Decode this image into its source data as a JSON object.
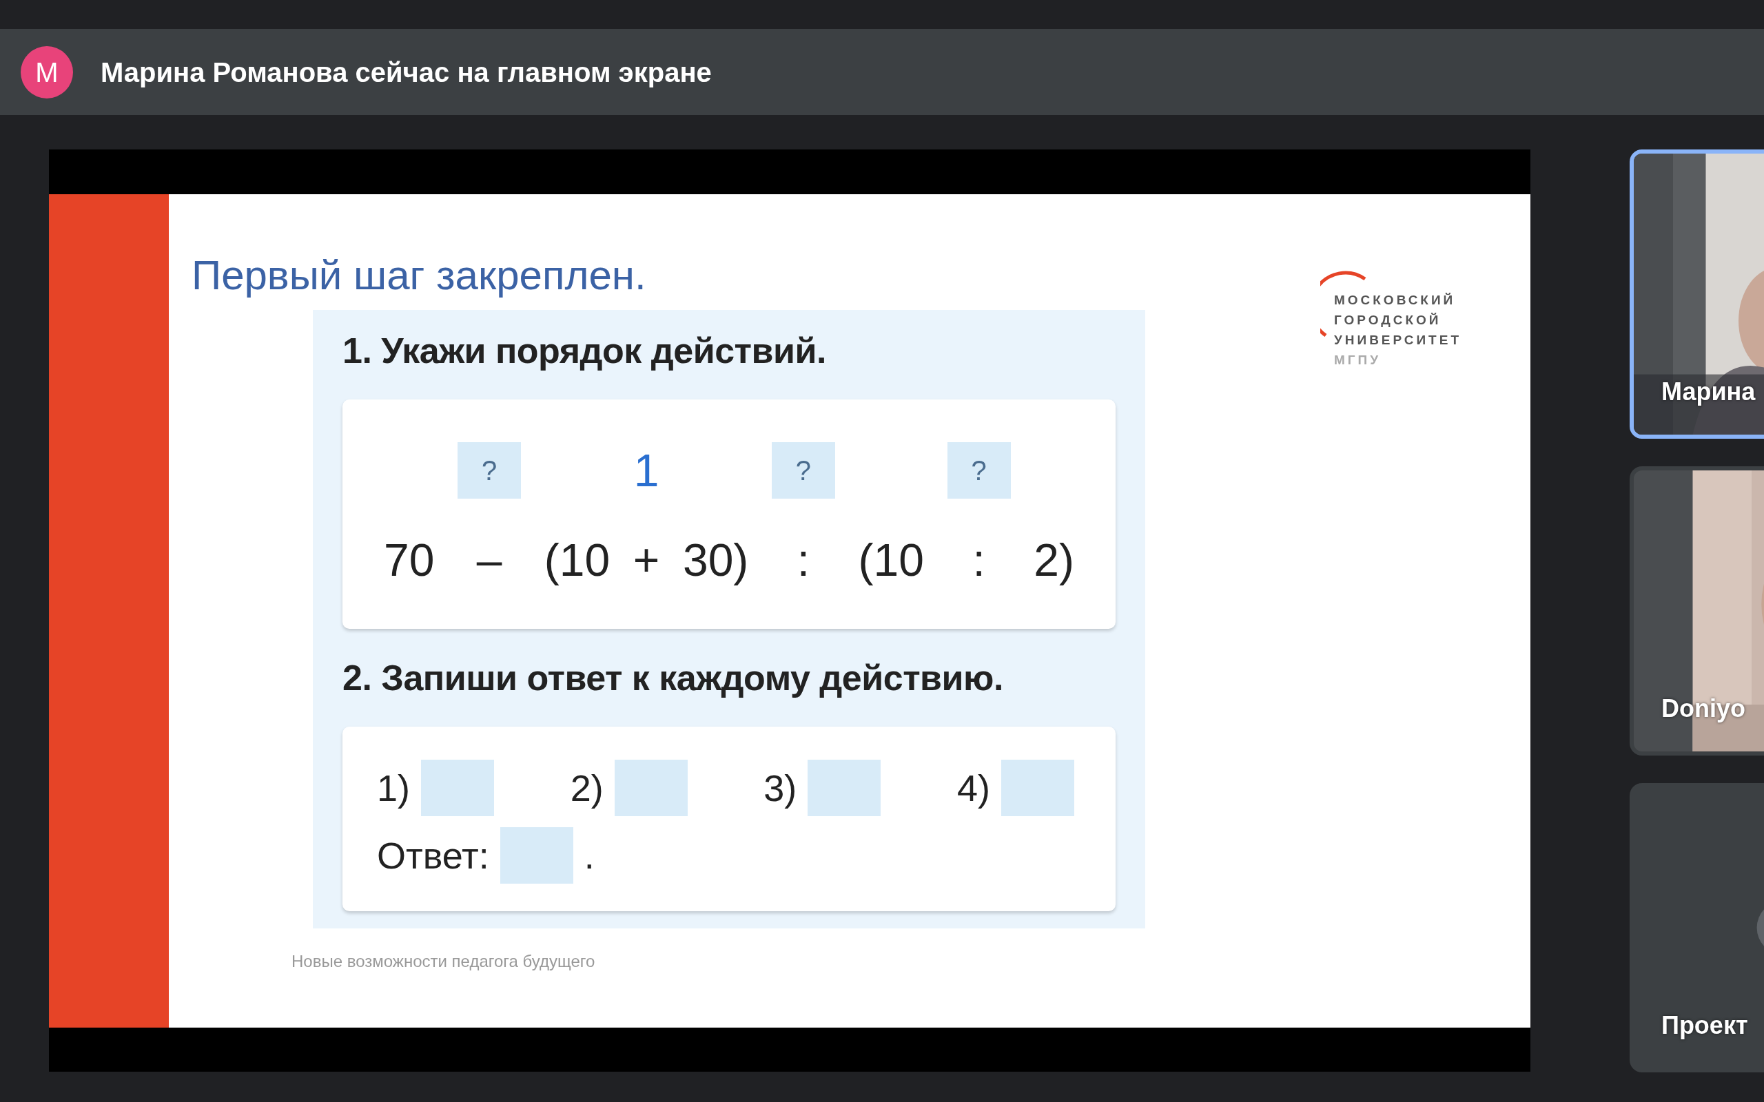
{
  "banner": {
    "avatar_letter": "М",
    "text": "Марина Романова сейчас на главном экране"
  },
  "slide": {
    "title": "Первый шаг закреплен.",
    "logo": {
      "lines": [
        "МОСКОВСКИЙ",
        "ГОРОДСКОЙ",
        "УНИВЕРСИТЕТ"
      ],
      "subline": "МГПУ"
    },
    "task1": {
      "heading": "1. Укажи порядок действий.",
      "tokens": [
        {
          "kind": "number",
          "text": "70"
        },
        {
          "kind": "operator",
          "text": "–",
          "order": {
            "kind": "blank",
            "text": "?"
          }
        },
        {
          "kind": "number",
          "text": "(10"
        },
        {
          "kind": "operator",
          "text": "+",
          "order": {
            "kind": "filled",
            "text": "1"
          }
        },
        {
          "kind": "number",
          "text": "30)"
        },
        {
          "kind": "operator",
          "text": ":",
          "order": {
            "kind": "blank",
            "text": "?"
          }
        },
        {
          "kind": "number",
          "text": "(10"
        },
        {
          "kind": "operator",
          "text": ":",
          "order": {
            "kind": "blank",
            "text": "?"
          }
        },
        {
          "kind": "number",
          "text": "2)"
        }
      ]
    },
    "task2": {
      "heading": "2. Запиши ответ к каждому действию.",
      "steps": [
        "1)",
        "2)",
        "3)",
        "4)"
      ],
      "answer_label": "Ответ:",
      "answer_end": "."
    },
    "footer": "Новые возможности педагога будущего"
  },
  "participants": [
    {
      "name": "Марина",
      "kind": "video",
      "selected": true
    },
    {
      "name": "Doniyo",
      "kind": "video",
      "selected": false
    },
    {
      "name": "Проект",
      "kind": "avatar",
      "selected": false
    }
  ]
}
